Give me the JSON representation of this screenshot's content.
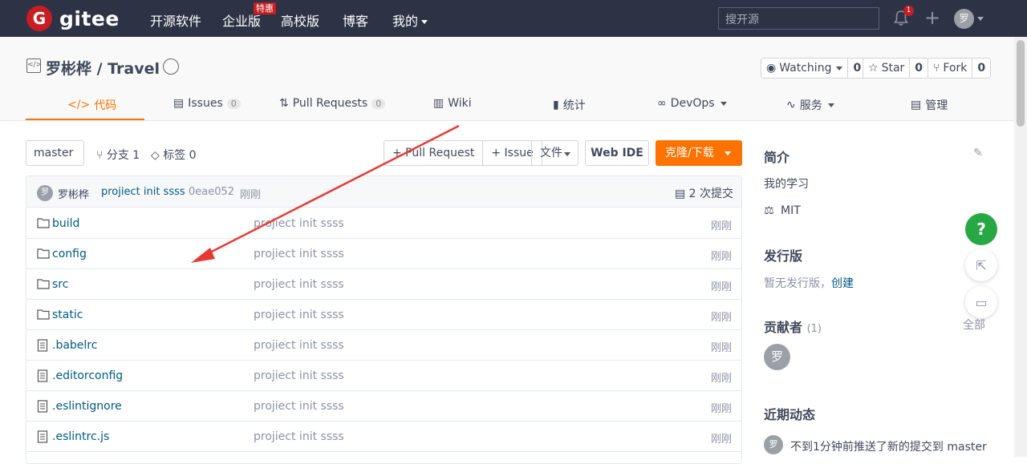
{
  "topbar": {
    "logo_mark": "G",
    "logo_text": "gitee",
    "nav": [
      "开源软件",
      "企业版",
      "高校版",
      "博客",
      "我的"
    ],
    "hot_badge": "特惠",
    "search_placeholder": "搜开源",
    "notification_count": "1",
    "plus": "+",
    "avatar_text": "罗"
  },
  "repo": {
    "icon": "</>",
    "title": "罗彬桦 / Travel",
    "watching": {
      "label": "Watching",
      "count": "0"
    },
    "star": {
      "label": "Star",
      "count": "0"
    },
    "fork": {
      "label": "Fork",
      "count": "0"
    }
  },
  "tabs": [
    {
      "icon": "</>",
      "label": "代码"
    },
    {
      "icon": "▤",
      "label": "Issues",
      "count": "0"
    },
    {
      "icon": "⇅",
      "label": "Pull Requests",
      "count": "0"
    },
    {
      "icon": "▥",
      "label": "Wiki"
    },
    {
      "icon": "▮",
      "label": "统计"
    },
    {
      "icon": "∞",
      "label": "DevOps"
    },
    {
      "icon": "∿",
      "label": "服务"
    },
    {
      "icon": "▤",
      "label": "管理"
    }
  ],
  "toolbar": {
    "branch": "master",
    "branches": "分支 1",
    "tags": "标签 0",
    "pull_request": "+ Pull Request",
    "issue": "+ Issue",
    "file": "文件",
    "webide": "Web IDE",
    "clone": "克隆/下载"
  },
  "commit": {
    "avatar": "罗",
    "author": "罗彬桦",
    "message": "projiect init ssss",
    "sha": "0eae052",
    "time": "刚刚",
    "total": "2 次提交"
  },
  "files": [
    {
      "name": "build",
      "type": "folder",
      "message": "projiect init ssss",
      "time": "刚刚"
    },
    {
      "name": "config",
      "type": "folder",
      "message": "projiect init ssss",
      "time": "刚刚"
    },
    {
      "name": "src",
      "type": "folder",
      "message": "projiect init ssss",
      "time": "刚刚"
    },
    {
      "name": "static",
      "type": "folder",
      "message": "projiect init ssss",
      "time": "刚刚"
    },
    {
      "name": ".babelrc",
      "type": "file",
      "message": "projiect init ssss",
      "time": "刚刚"
    },
    {
      "name": ".editorconfig",
      "type": "file",
      "message": "projiect init ssss",
      "time": "刚刚"
    },
    {
      "name": ".eslintignore",
      "type": "file",
      "message": "projiect init ssss",
      "time": "刚刚"
    },
    {
      "name": ".eslintrc.js",
      "type": "file",
      "message": "projiect init ssss",
      "time": "刚刚"
    }
  ],
  "sidebar": {
    "intro_title": "简介",
    "intro_text": "我的学习",
    "license": "MIT",
    "release_title": "发行版",
    "release_text": "暂无发行版，",
    "release_link": "创建",
    "contributors_title": "贡献者",
    "contributors_count": "(1)",
    "contributors_all": "全部",
    "contributor_avatar": "罗",
    "activity_title": "近期动态",
    "activity_avatar": "罗",
    "activity_text": "不到1分钟前推送了新的提交到 master"
  },
  "float": {
    "help": "?"
  },
  "colors": {
    "accent": "#fe7300",
    "topbar": "#2d3345",
    "link": "#005980",
    "help": "#27a844",
    "arrow": "#e53935"
  }
}
